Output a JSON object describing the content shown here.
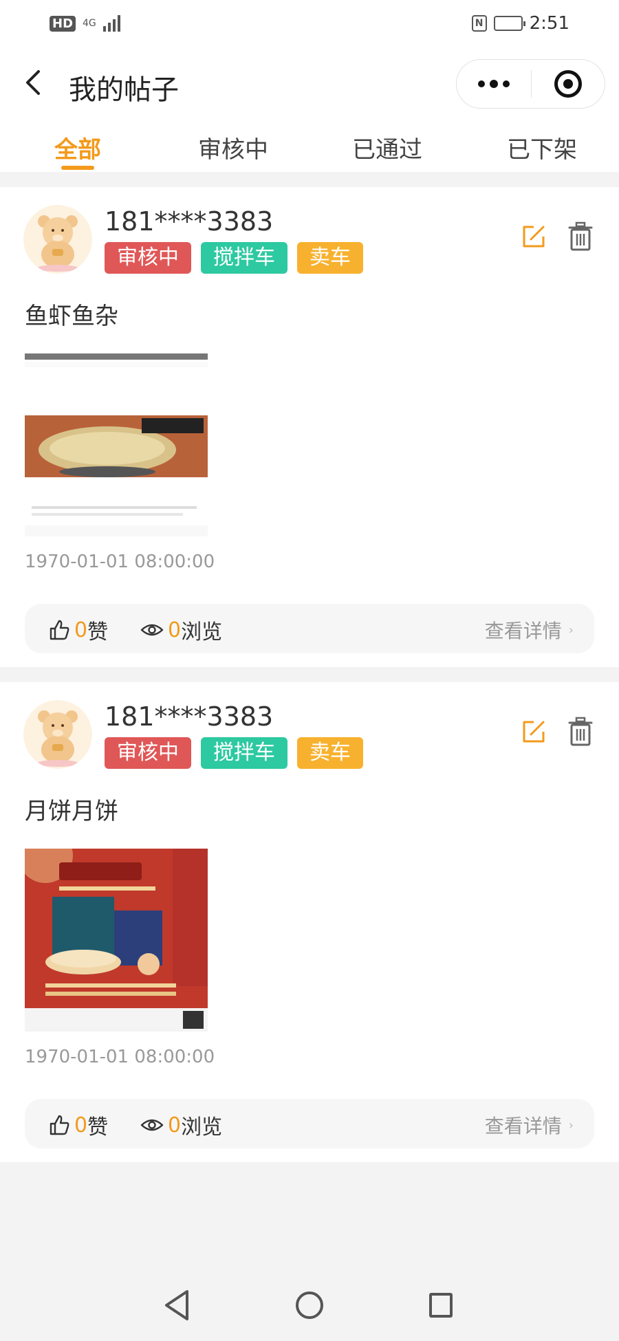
{
  "status_bar": {
    "hd": "HD",
    "network": "4G",
    "time": "2:51",
    "battery_level": 0.55
  },
  "header": {
    "title": "我的帖子"
  },
  "tabs": [
    {
      "label": "全部",
      "active": true
    },
    {
      "label": "审核中",
      "active": false
    },
    {
      "label": "已通过",
      "active": false
    },
    {
      "label": "已下架",
      "active": false
    }
  ],
  "colors": {
    "accent": "#f39a1c",
    "tag_status": "#e05757",
    "tag_category": "#2dc9a1",
    "tag_type": "#f8b12e"
  },
  "posts": [
    {
      "user": "181****3383",
      "tags": [
        "审核中",
        "搅拌车",
        "卖车"
      ],
      "text": "鱼虾鱼杂",
      "time": "1970-01-01 08:00:00",
      "likes": "0",
      "like_label": "赞",
      "views": "0",
      "view_label": "浏览",
      "detail": "查看详情"
    },
    {
      "user": "181****3383",
      "tags": [
        "审核中",
        "搅拌车",
        "卖车"
      ],
      "text": "月饼月饼",
      "time": "1970-01-01 08:00:00",
      "likes": "0",
      "like_label": "赞",
      "views": "0",
      "view_label": "浏览",
      "detail": "查看详情"
    }
  ]
}
